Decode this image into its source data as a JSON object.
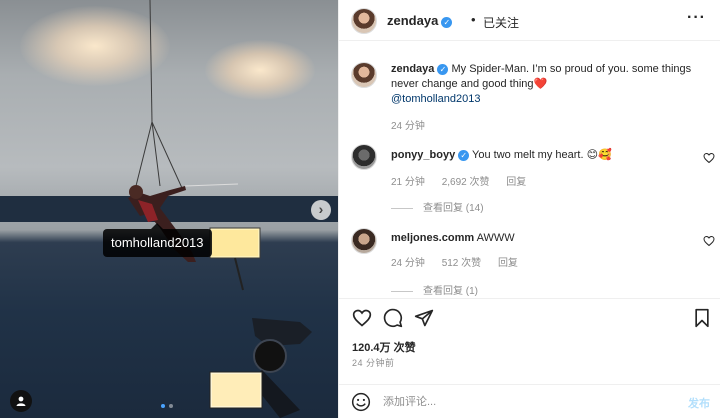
{
  "photo": {
    "user_tag": "tomholland2013",
    "carousel": {
      "total": 2,
      "active": 1
    }
  },
  "post": {
    "author": "zendaya",
    "follow_status": "已关注",
    "caption": {
      "username": "zendaya",
      "text": "My Spider-Man. I’m so proud of you. some things never change and good thing",
      "emoji": "❤️",
      "mention": "@tomholland2013",
      "time": "24 分钟"
    },
    "comments": [
      {
        "username": "ponyy_boyy",
        "verified": true,
        "text": "You two melt my heart. 😊🥰",
        "time": "21 分钟",
        "likes": "2,692 次赞",
        "reply": "回复",
        "view_replies": "查看回复 (14)"
      },
      {
        "username": "meljones.comm",
        "verified": false,
        "text": "AWWW",
        "time": "24 分钟",
        "likes": "512 次赞",
        "reply": "回复",
        "view_replies": "查看回复 (1)"
      }
    ],
    "likes_count": "120.4万 次赞",
    "posted_ago": "24 分钟前",
    "composer": {
      "placeholder": "添加评论...",
      "post_label": "发布"
    }
  },
  "colors": {
    "verified": "#3897f0",
    "link": "#00376b",
    "muted": "#8e8e8e",
    "post_button": "#b2dffc"
  }
}
